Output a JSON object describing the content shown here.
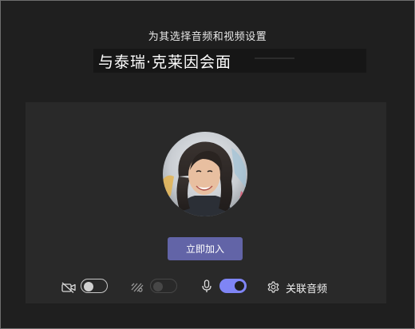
{
  "dialog": {
    "subtitle": "为其选择音频和视频设置",
    "meeting_title": "与泰瑞·克莱因会面"
  },
  "join": {
    "button_label": "立即加入"
  },
  "controls": {
    "camera": {
      "icon": "camera-off-icon",
      "state": "off"
    },
    "background_blur": {
      "icon": "background-blur-icon",
      "state": "disabled"
    },
    "microphone": {
      "icon": "microphone-icon",
      "state": "on"
    },
    "device_settings": {
      "icon": "gear-icon",
      "label": "关联音频"
    }
  },
  "colors": {
    "accent": "#6264a7",
    "toggle_on": "#7f85f5",
    "card": "#292929",
    "background": "#1f1f1f"
  }
}
